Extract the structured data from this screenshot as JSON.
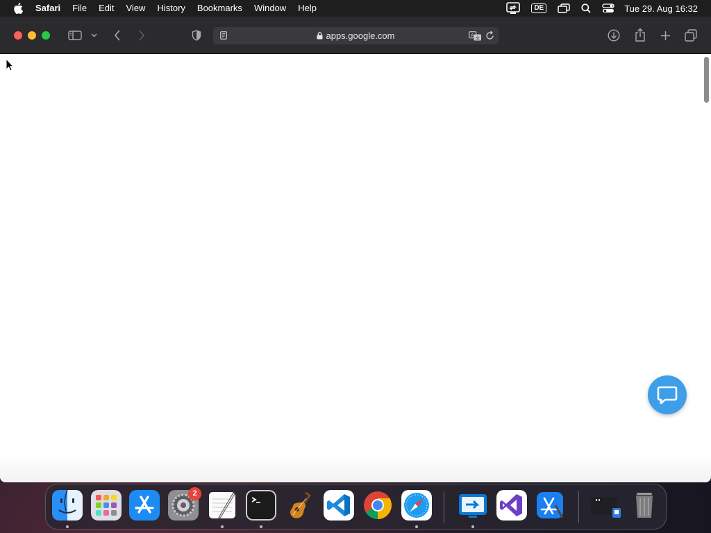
{
  "menubar": {
    "app_name": "Safari",
    "items": [
      "File",
      "Edit",
      "View",
      "History",
      "Bookmarks",
      "Window",
      "Help"
    ],
    "input_language": "DE",
    "clock": "Tue 29. Aug  16:32"
  },
  "safari": {
    "url": "apps.google.com"
  },
  "dock": {
    "settings_badge": "2",
    "apps": [
      "Finder",
      "Launchpad",
      "App Store",
      "System Settings",
      "TextEdit",
      "Terminal",
      "GarageBand",
      "Visual Studio Code",
      "Google Chrome",
      "Safari",
      "Microsoft Remote Desktop",
      "Visual Studio",
      "Xcode",
      "Downloads",
      "Trash"
    ]
  },
  "colors": {
    "menubar_bg": "#1e1e1f",
    "toolbar_bg": "#2b2b2d",
    "chat_fab": "#3d9ee9",
    "badge": "#e8433a"
  }
}
